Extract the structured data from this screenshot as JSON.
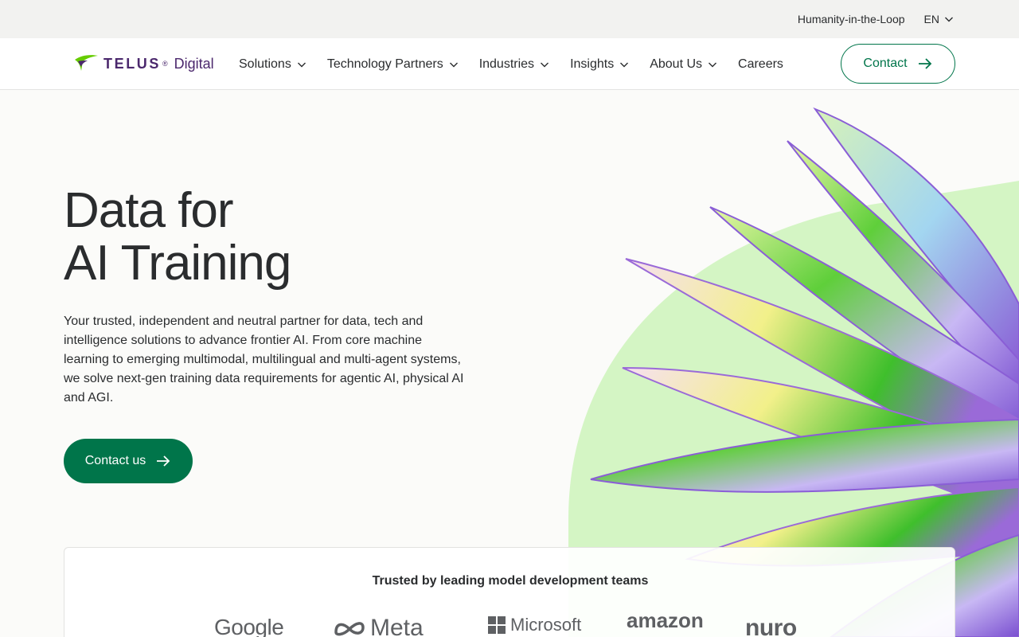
{
  "utility_bar": {
    "link_label": "Humanity-in-the-Loop",
    "language": "EN"
  },
  "header": {
    "logo_word": "TELUS",
    "logo_sub": "Digital",
    "logo_reg": "®",
    "nav": [
      {
        "label": "Solutions",
        "has_dropdown": true
      },
      {
        "label": "Technology Partners",
        "has_dropdown": true
      },
      {
        "label": "Industries",
        "has_dropdown": true
      },
      {
        "label": "Insights",
        "has_dropdown": true
      },
      {
        "label": "About Us",
        "has_dropdown": true
      },
      {
        "label": "Careers",
        "has_dropdown": false
      }
    ],
    "contact_label": "Contact"
  },
  "hero": {
    "title_line1": "Data for",
    "title_line2": "AI Training",
    "description": "Your trusted, independent and neutral partner for data, tech and intelligence solutions to advance frontier AI. From core machine learning to emerging multimodal, multilingual and multi-agent systems, we solve next-gen training data requirements for agentic AI, physical AI and AGI.",
    "cta_label": "Contact us"
  },
  "trusted": {
    "title": "Trusted by leading model development teams",
    "logos": [
      "Google",
      "Meta",
      "Microsoft",
      "amazon",
      "nuro"
    ]
  },
  "colors": {
    "brand_green": "#00754a",
    "brand_purple": "#4b286d",
    "logo_green": "#66cc00",
    "accent_mint": "#d4f5c4"
  },
  "icons": {
    "chevron": "chevron-down-icon",
    "arrow": "arrow-right-icon"
  }
}
